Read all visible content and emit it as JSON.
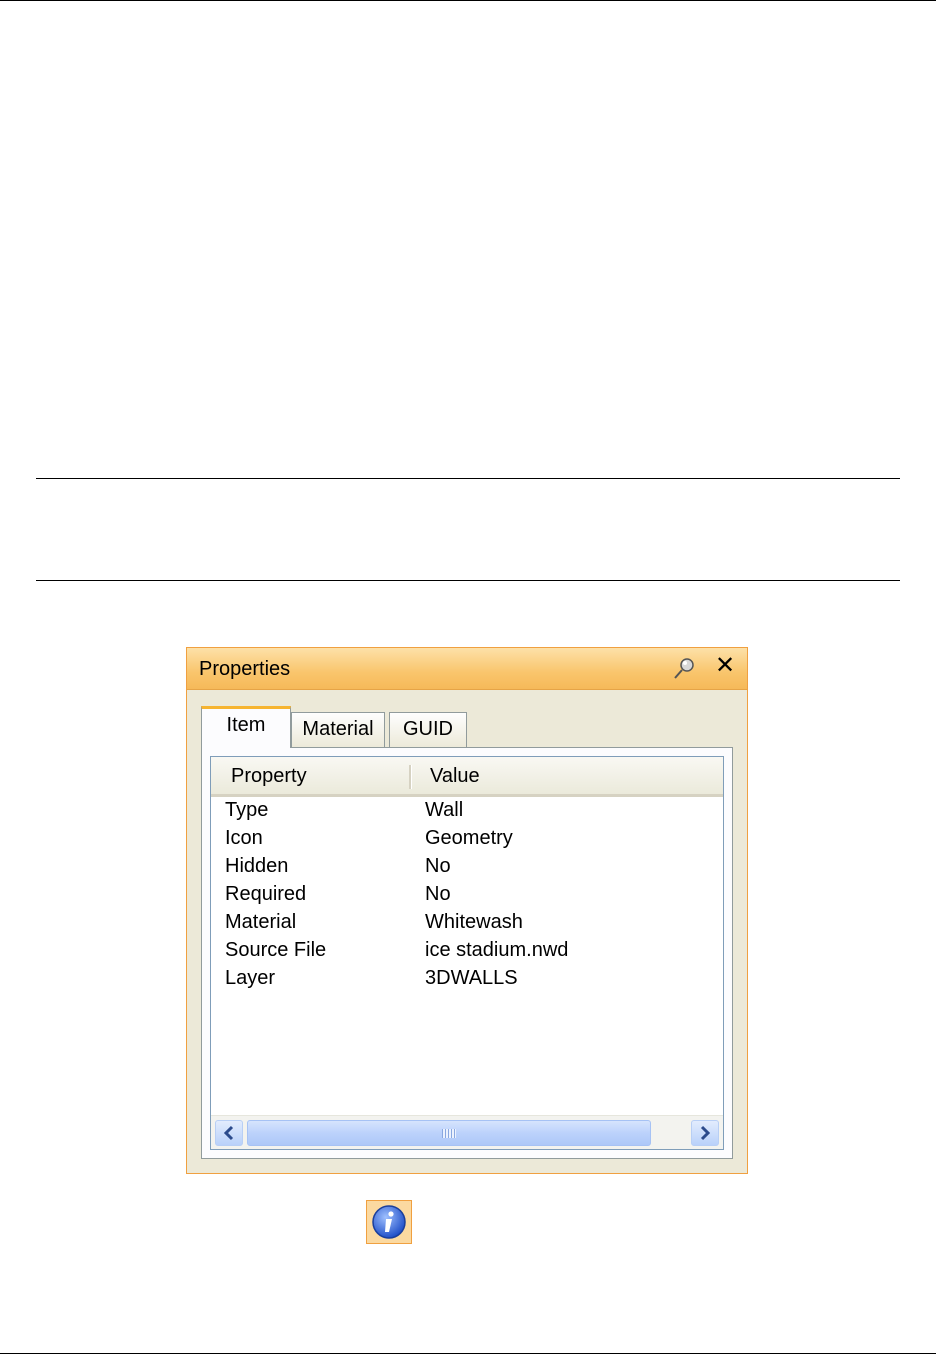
{
  "panel": {
    "title": "Properties",
    "tabs": [
      {
        "label": "Item",
        "active": true
      },
      {
        "label": "Material",
        "active": false
      },
      {
        "label": "GUID",
        "active": false
      }
    ],
    "columns": {
      "property": "Property",
      "value": "Value"
    },
    "rows": [
      {
        "property": "Type",
        "value": "Wall"
      },
      {
        "property": "Icon",
        "value": "Geometry"
      },
      {
        "property": "Hidden",
        "value": "No"
      },
      {
        "property": "Required",
        "value": "No"
      },
      {
        "property": "Material",
        "value": "Whitewash"
      },
      {
        "property": "Source File",
        "value": "ice stadium.nwd"
      },
      {
        "property": "Layer",
        "value": "3DWALLS"
      }
    ],
    "icons": {
      "pin": "pin-icon",
      "close": "close-icon"
    }
  },
  "colors": {
    "title_bar": "#f9c56c",
    "panel_border": "#f0a040",
    "scrollbar": "#bcd2fb"
  },
  "note_icon": "info-icon"
}
